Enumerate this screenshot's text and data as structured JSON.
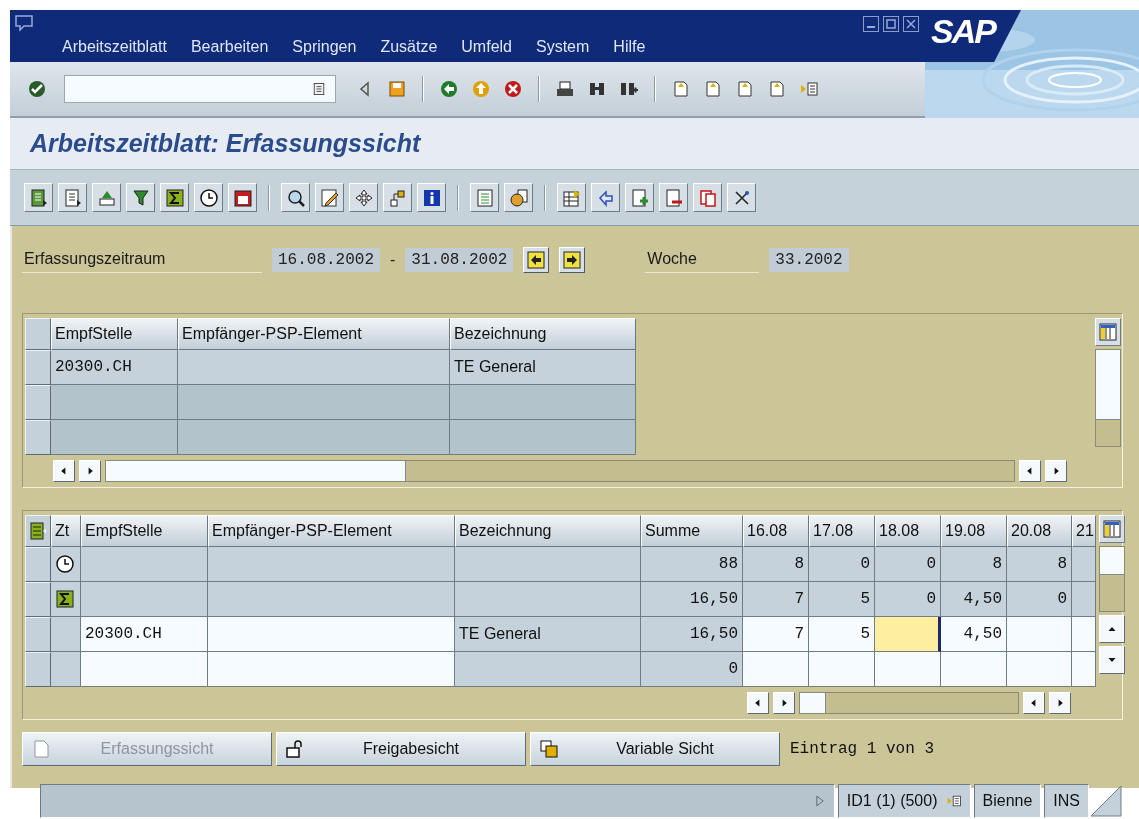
{
  "window": {
    "logo": "SAP"
  },
  "menu": [
    {
      "label": "Arbeitszeitblatt"
    },
    {
      "label": "Bearbeiten"
    },
    {
      "label": "Springen"
    },
    {
      "label": "Zusätze"
    },
    {
      "label": "Umfeld"
    },
    {
      "label": "System"
    },
    {
      "label": "Hilfe"
    }
  ],
  "title": "Arbeitszeitblatt: Erfassungssicht",
  "period": {
    "label": "Erfassungszeitraum",
    "from": "16.08.2002",
    "separator": "-",
    "to": "31.08.2002",
    "week_label": "Woche",
    "week": "33.2002"
  },
  "assignments": {
    "columns": [
      "EmpfStelle",
      "Empfänger-PSP-Element",
      "Bezeichnung"
    ],
    "rows": [
      [
        "20300.CH",
        null,
        "TE General"
      ],
      [
        null,
        null,
        null
      ],
      [
        null,
        null,
        null
      ]
    ]
  },
  "times": {
    "columns": [
      "Zt",
      "EmpfStelle",
      "Empfänger-PSP-Element",
      "Bezeichnung",
      "Summe"
    ],
    "days": [
      "16.08",
      "17.08",
      "18.08",
      "19.08",
      "20.08",
      "21"
    ],
    "rows": [
      {
        "kind": "target",
        "empf_stelle": null,
        "psp": null,
        "bezeichnung": null,
        "summe": "88",
        "values": [
          {
            "value": "8",
            "focused": false
          },
          {
            "value": "0",
            "focused": false
          },
          {
            "value": "0",
            "focused": false
          },
          {
            "value": "8",
            "focused": false
          },
          {
            "value": "8",
            "focused": false
          },
          {
            "focused": false
          }
        ]
      },
      {
        "kind": "total",
        "empf_stelle": null,
        "psp": null,
        "bezeichnung": null,
        "summe": "16,50",
        "values": [
          {
            "value": "7",
            "focused": false
          },
          {
            "value": "5",
            "focused": false
          },
          {
            "value": "0",
            "focused": false
          },
          {
            "value": "4,50",
            "focused": false
          },
          {
            "value": "0",
            "focused": false
          },
          {
            "focused": false
          }
        ]
      },
      {
        "kind": "entry",
        "empf_stelle": "20300.CH",
        "psp": null,
        "bezeichnung": "TE General",
        "summe": "16,50",
        "values": [
          {
            "value": "7",
            "focused": false
          },
          {
            "value": "5",
            "focused": false
          },
          {
            "focused": true
          },
          {
            "value": "4,50",
            "focused": false
          },
          {
            "focused": false
          },
          {
            "focused": false
          }
        ]
      },
      {
        "kind": "entry",
        "empf_stelle": null,
        "psp": null,
        "bezeichnung": null,
        "summe": "0",
        "values": [
          {
            "focused": false
          },
          {
            "focused": false
          },
          {
            "focused": false
          },
          {
            "focused": false
          },
          {
            "focused": false
          },
          {
            "focused": false
          }
        ]
      }
    ]
  },
  "buttons": [
    {
      "label": "Erfassungssicht",
      "disabled": true,
      "kind": "page"
    },
    {
      "label": "Freigabesicht",
      "disabled": false,
      "kind": "lock"
    },
    {
      "label": "Variable Sicht",
      "disabled": false,
      "kind": "windows"
    }
  ],
  "entry_info": "Eintrag 1 von 3",
  "status_bar": {
    "system": "ID1 (1) (500)",
    "host": "Bienne",
    "mode": "INS"
  }
}
